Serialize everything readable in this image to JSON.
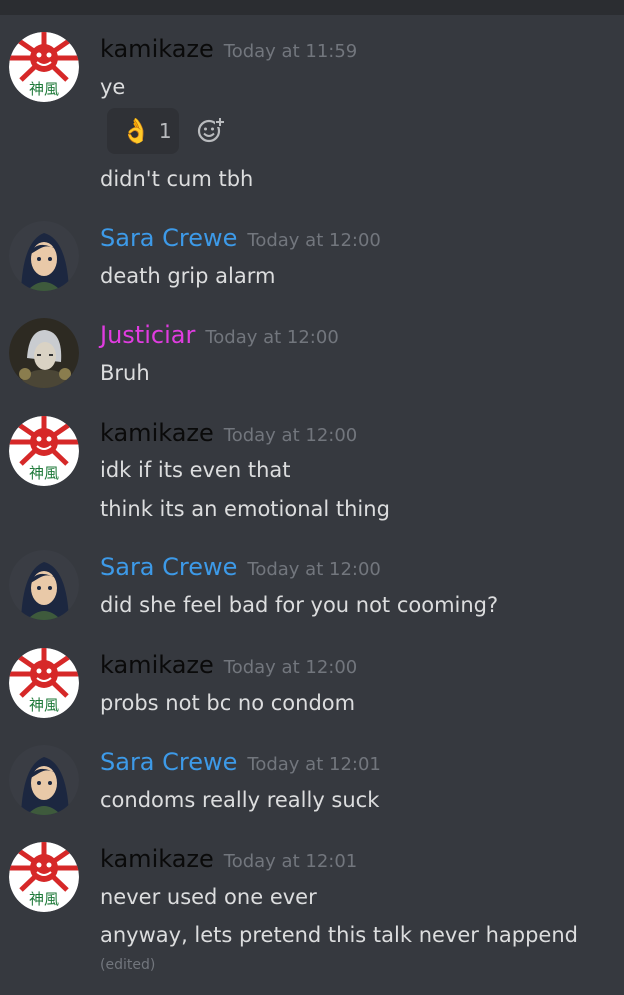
{
  "colors": {
    "background": "#36393f",
    "kamikaze": "#0a0a0a",
    "sara": "#3d9ae8",
    "justiciar": "#e03ce0"
  },
  "avatars": {
    "kamikaze_kanji": "神風"
  },
  "groups": [
    {
      "author": "kamikaze",
      "timestamp": "Today at 11:59",
      "lines": [
        "ye"
      ],
      "reaction": {
        "emoji": "👌",
        "count": "1"
      },
      "after_reaction": [
        "didn't cum tbh"
      ]
    },
    {
      "author": "Sara Crewe",
      "timestamp": "Today at 12:00",
      "lines": [
        "death grip alarm"
      ]
    },
    {
      "author": "Justiciar",
      "timestamp": "Today at 12:00",
      "lines": [
        "Bruh"
      ]
    },
    {
      "author": "kamikaze",
      "timestamp": "Today at 12:00",
      "lines": [
        "idk if its even that",
        "think its an emotional thing"
      ]
    },
    {
      "author": "Sara Crewe",
      "timestamp": "Today at 12:00",
      "lines": [
        "did she feel bad for you not cooming?"
      ]
    },
    {
      "author": "kamikaze",
      "timestamp": "Today at 12:00",
      "lines": [
        "probs not bc no condom"
      ]
    },
    {
      "author": "Sara Crewe",
      "timestamp": "Today at 12:01",
      "lines": [
        "condoms really really suck"
      ]
    },
    {
      "author": "kamikaze",
      "timestamp": "Today at 12:01",
      "lines": [
        "never used one ever",
        "anyway, lets pretend this talk never happend"
      ],
      "edited": "(edited)"
    }
  ]
}
